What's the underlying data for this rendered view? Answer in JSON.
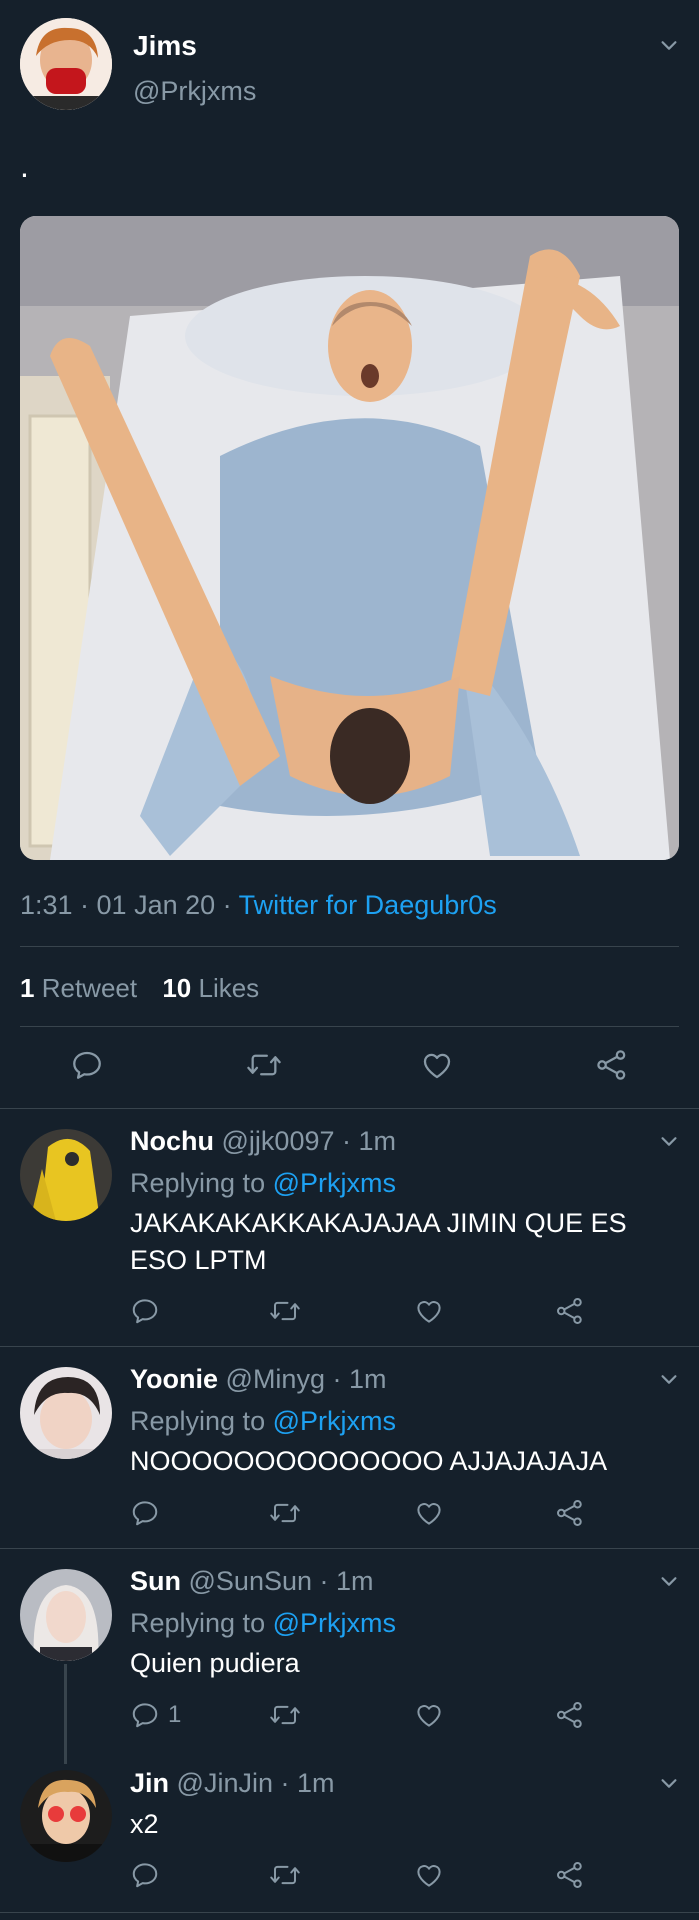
{
  "tweet": {
    "author_name": "Jims",
    "author_handle": "@Prkjxms",
    "text": ".",
    "timestamp": "1:31 · 01 Jan 20 ·",
    "source": "Twitter for Daegubr0s",
    "retweets_count": "1",
    "retweets_label": "Retweet",
    "likes_count": "10",
    "likes_label": "Likes"
  },
  "replies": [
    {
      "name": "Nochu",
      "handle_time": "@jjk0097 · 1m",
      "replying_prefix": "Replying to",
      "replying_to": "@Prkjxms",
      "body": "JAKAKAKAKKAKAJAJAA JIMIN QUE ES ESO LPTM",
      "reply_count": ""
    },
    {
      "name": "Yoonie",
      "handle_time": "@Minyg · 1m",
      "replying_prefix": "Replying to",
      "replying_to": "@Prkjxms",
      "body": "NOOOOOOOOOOOOOO AJJAJAJAJA",
      "reply_count": ""
    },
    {
      "name": "Sun",
      "handle_time": "@SunSun · 1m",
      "replying_prefix": "Replying to",
      "replying_to": "@Prkjxms",
      "body": "Quien pudiera",
      "reply_count": "1"
    },
    {
      "name": "Jin",
      "handle_time": "@JinJin · 1m",
      "body": "x2",
      "reply_count": ""
    }
  ],
  "colors": {
    "background": "#15202b",
    "accent": "#1da1f2",
    "muted": "#8899a6",
    "divider": "#38444d"
  }
}
